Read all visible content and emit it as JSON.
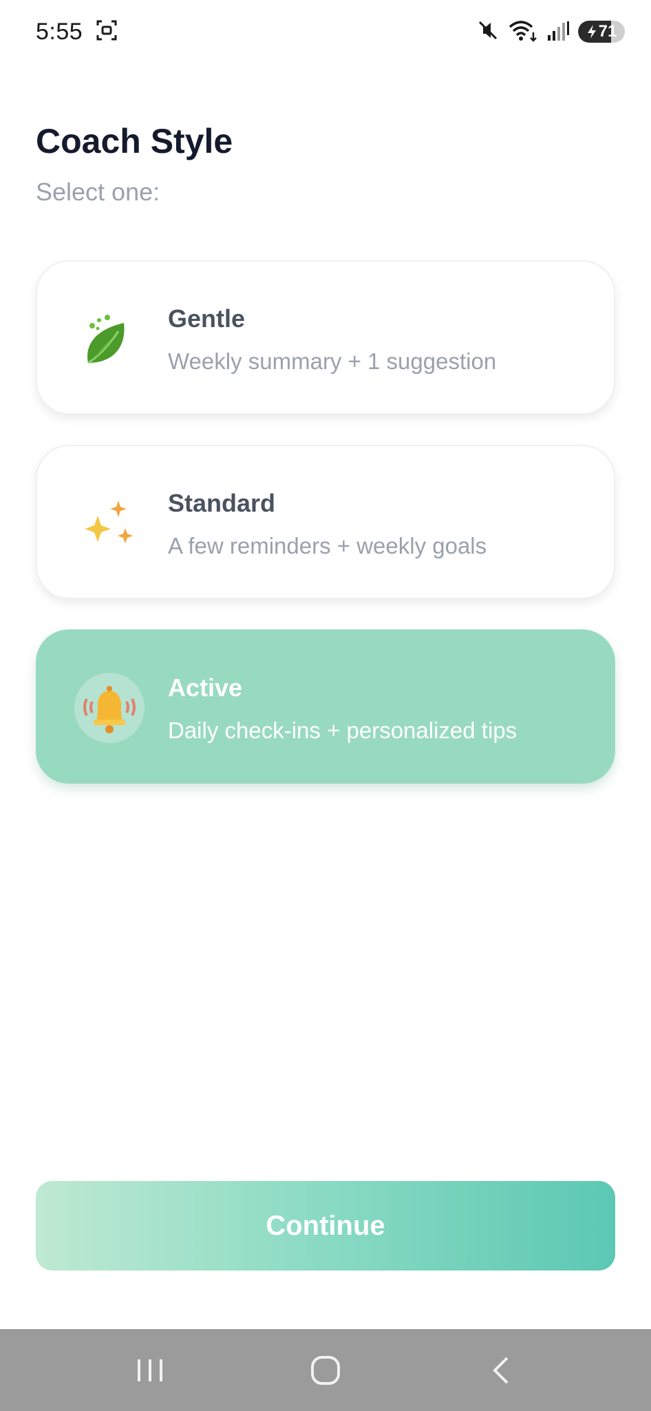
{
  "status_bar": {
    "time": "5:55",
    "battery_level": "71",
    "icons": [
      "screenshot-icon",
      "mute-icon",
      "wifi-icon",
      "signal-icon",
      "battery-icon"
    ]
  },
  "header": {
    "title": "Coach Style",
    "subtitle": "Select one:"
  },
  "options": [
    {
      "title": "Gentle",
      "description": "Weekly summary + 1 suggestion",
      "icon": "leaf-icon",
      "selected": false
    },
    {
      "title": "Standard",
      "description": "A few reminders + weekly goals",
      "icon": "sparkles-icon",
      "selected": false
    },
    {
      "title": "Active",
      "description": "Daily check-ins + personalized tips",
      "icon": "bell-icon",
      "selected": true
    }
  ],
  "continue_button": {
    "label": "Continue"
  },
  "nav_bar": {
    "buttons": [
      "recents-icon",
      "home-icon",
      "back-icon"
    ]
  },
  "colors": {
    "selected_card": "#98dac0",
    "title_text": "#151a2d",
    "muted_text": "#9aa1ab",
    "button_gradient_start": "#bfe9d2",
    "button_gradient_end": "#5cc8b3"
  }
}
